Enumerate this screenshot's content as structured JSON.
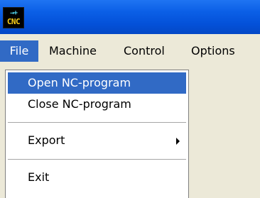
{
  "window": {
    "icon": {
      "name": "cnc-app-icon",
      "pins": "→+",
      "text": "CNC"
    },
    "title": ""
  },
  "menubar": {
    "items": [
      {
        "label": "File",
        "active": true
      },
      {
        "label": "Machine"
      },
      {
        "label": "Control"
      },
      {
        "label": "Options"
      }
    ]
  },
  "file_menu": {
    "items": [
      {
        "label": "Open NC-program",
        "highlighted": true
      },
      {
        "label": "Close NC-program"
      },
      {
        "label": "Export",
        "submenu": true,
        "submenu_icon": "submenu-arrow-icon"
      },
      {
        "label": "Exit"
      }
    ]
  },
  "colors": {
    "titlebar": "#0451d9",
    "menubar": "#ece9d8",
    "highlight": "#316ac5",
    "highlight_text": "#ffffff"
  }
}
